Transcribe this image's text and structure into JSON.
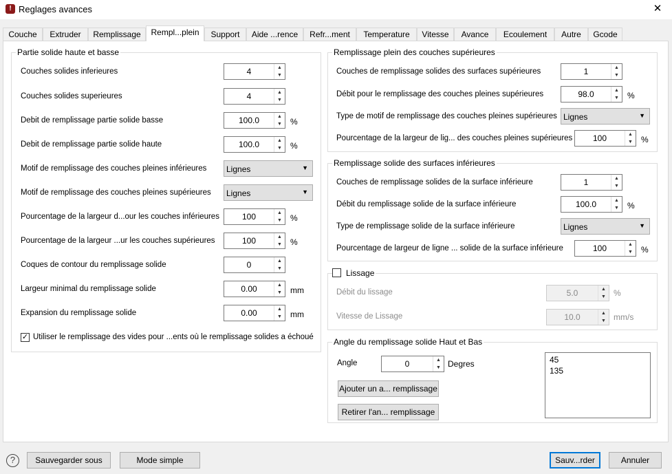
{
  "window": {
    "title": "Reglages avances",
    "close": "✕"
  },
  "tabs": [
    "Couche",
    "Extruder",
    "Remplissage",
    "Rempl...plein",
    "Support",
    "Aide ...rence",
    "Refr...ment",
    "Temperature",
    "Vitesse",
    "Avance",
    "Ecoulement",
    "Autre",
    "Gcode"
  ],
  "left": {
    "title": "Partie solide haute et basse",
    "rows": [
      {
        "label": "Couches solides inferieures",
        "type": "spin",
        "value": "4",
        "unit": ""
      },
      {
        "label": "Couches solides superieures",
        "type": "spin",
        "value": "4",
        "unit": ""
      },
      {
        "label": "Debit de remplissage partie solide basse",
        "type": "spin",
        "value": "100.0",
        "unit": "%"
      },
      {
        "label": "Debit de remplissage partie solide haute",
        "type": "spin",
        "value": "100.0",
        "unit": "%"
      },
      {
        "label": "Motif de remplissage des couches pleines inférieures",
        "type": "combo",
        "value": "Lignes",
        "unit": ""
      },
      {
        "label": "Motif de remplissage des couches pleines supérieures",
        "type": "combo",
        "value": "Lignes",
        "unit": ""
      },
      {
        "label": "Pourcentage de la largeur d...our les couches inférieures",
        "type": "spin",
        "value": "100",
        "unit": "%"
      },
      {
        "label": "Pourcentage de la largeur ...ur les couches supérieures",
        "type": "spin",
        "value": "100",
        "unit": "%"
      },
      {
        "label": "Coques de contour du remplissage solide",
        "type": "spin",
        "value": "0",
        "unit": ""
      },
      {
        "label": "Largeur minimal du remplissage solide",
        "type": "spin",
        "value": "0.00",
        "unit": "mm"
      },
      {
        "label": "Expansion du remplissage solide",
        "type": "spin",
        "value": "0.00",
        "unit": "mm"
      }
    ],
    "checkbox": {
      "label": "Utiliser le remplissage des vides pour ...ents où le remplissage solides a échoué",
      "checked": true,
      "mark": "✓"
    }
  },
  "top": {
    "title": "Remplissage plein des couches supérieures",
    "rows": [
      {
        "label": "Couches de remplissage solides des surfaces supérieures",
        "type": "spin",
        "value": "1",
        "unit": ""
      },
      {
        "label": "Débit pour le remplissage des couches pleines supérieures",
        "type": "spin",
        "value": "98.0",
        "unit": "%"
      },
      {
        "label": "Type de motif de remplissage des couches pleines supérieures",
        "type": "combo",
        "value": "Lignes",
        "unit": ""
      },
      {
        "label": "Pourcentage de la largeur de lig... des couches pleines supérieures",
        "type": "spin2",
        "value": "100",
        "unit": "%"
      }
    ]
  },
  "bottom": {
    "title": "Remplissage solide des surfaces inférieures",
    "rows": [
      {
        "label": "Couches de remplissage solides de la surface inférieure",
        "type": "spin",
        "value": "1",
        "unit": ""
      },
      {
        "label": "Débit du remplissage solide de la surface inférieure",
        "type": "spin",
        "value": "100.0",
        "unit": "%"
      },
      {
        "label": "Type de remplissage solide de la surface inférieure",
        "type": "combo",
        "value": "Lignes",
        "unit": ""
      },
      {
        "label": "Pourcentage de largeur de ligne ... solide de la surface inférieure",
        "type": "spin2",
        "value": "100",
        "unit": "%"
      }
    ]
  },
  "smoothing": {
    "title": "Lissage",
    "checked": false,
    "rows": [
      {
        "label": "Débit du lissage",
        "value": "5.0",
        "unit": "%"
      },
      {
        "label": "Vitesse de Lissage",
        "value": "10.0",
        "unit": "mm/s"
      }
    ]
  },
  "angle": {
    "title": "Angle du remplissage solide Haut et Bas",
    "label": "Angle",
    "value": "0",
    "unit": "Degres",
    "add": "Ajouter un a... remplissage",
    "remove": "Retirer l'an... remplissage",
    "list": [
      "45",
      "135"
    ]
  },
  "footer": {
    "help": "?",
    "save_as": "Sauvegarder sous",
    "simple": "Mode simple",
    "save": "Sauv...rder",
    "cancel": "Annuler"
  }
}
